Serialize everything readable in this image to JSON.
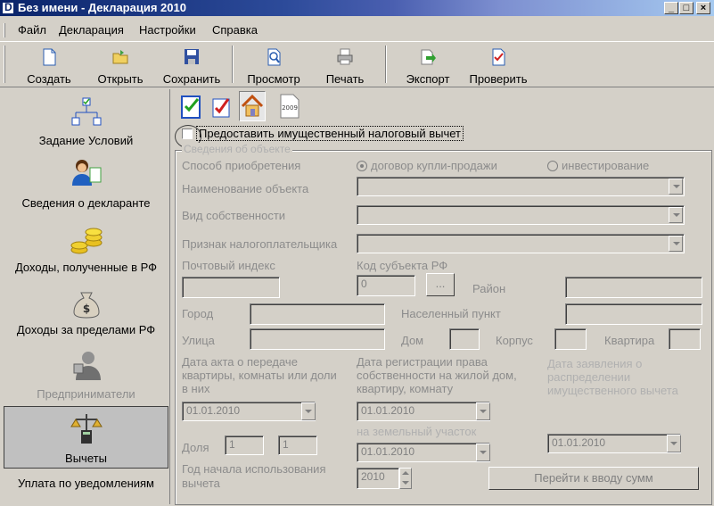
{
  "window": {
    "title": "Без имени - Декларация 2010"
  },
  "menu": [
    "Файл",
    "Декларация",
    "Настройки",
    "Справка"
  ],
  "toolbar": {
    "buttons": [
      {
        "label": "Создать",
        "icon": "new-file-icon"
      },
      {
        "label": "Открыть",
        "icon": "open-folder-icon"
      },
      {
        "label": "Сохранить",
        "icon": "save-disk-icon"
      },
      {
        "label": "Просмотр",
        "icon": "preview-icon"
      },
      {
        "label": "Печать",
        "icon": "printer-icon"
      },
      {
        "label": "Экспорт",
        "icon": "export-icon"
      },
      {
        "label": "Проверить",
        "icon": "check-document-icon"
      }
    ]
  },
  "nav": {
    "items": [
      {
        "label": "Задание Условий",
        "icon": "flowchart-icon"
      },
      {
        "label": "Сведения о декларанте",
        "icon": "person-icon"
      },
      {
        "label": "Доходы, полученные в РФ",
        "icon": "coins-icon"
      },
      {
        "label": "Доходы за пределами РФ",
        "icon": "money-bag-icon"
      },
      {
        "label": "Предприниматели",
        "icon": "businessman-icon"
      },
      {
        "label": "Вычеты",
        "icon": "scales-calculator-icon"
      },
      {
        "label": "Уплата по уведомлениям",
        "icon": ""
      }
    ],
    "selected": "Вычеты"
  },
  "form": {
    "grant_checkbox_label": "Предоставить имущественный налоговый вычет",
    "section_title": "Сведения об объекте",
    "acquisition_label": "Способ приобретения",
    "radio_purchase": "договор купли-продажи",
    "radio_investment": "инвестирование",
    "object_name_label": "Наименование объекта",
    "ownership_label": "Вид собственности",
    "taxpayer_sign_label": "Признак налогоплательщика",
    "postal_code_label": "Почтовый индекс",
    "region_code_label": "Код субъекта РФ",
    "region_code_value": "0",
    "region_code_button": "...",
    "district_label": "Район",
    "city_label": "Город",
    "locality_label": "Населенный пункт",
    "street_label": "Улица",
    "house_label": "Дом",
    "building_label": "Корпус",
    "apartment_label": "Квартира",
    "transfer_act_label": "Дата акта о передаче квартиры, комнаты или доли в них",
    "transfer_act_value": "01.01.2010",
    "registration_label": "Дата регистрации права собственности на жилой дом, квартиру, комнату",
    "registration_value": "01.01.2010",
    "land_label": "на земельный участок",
    "land_value": "01.01.2010",
    "application_label": "Дата заявления о распределении имущественного вычета",
    "application_value": "01.01.2010",
    "share_label": "Доля",
    "share_numerator": "1",
    "share_denominator": "1",
    "start_year_label": "Год начала использования вычета",
    "start_year_value": "2010",
    "go_to_sums_button": "Перейти к вводу сумм"
  }
}
